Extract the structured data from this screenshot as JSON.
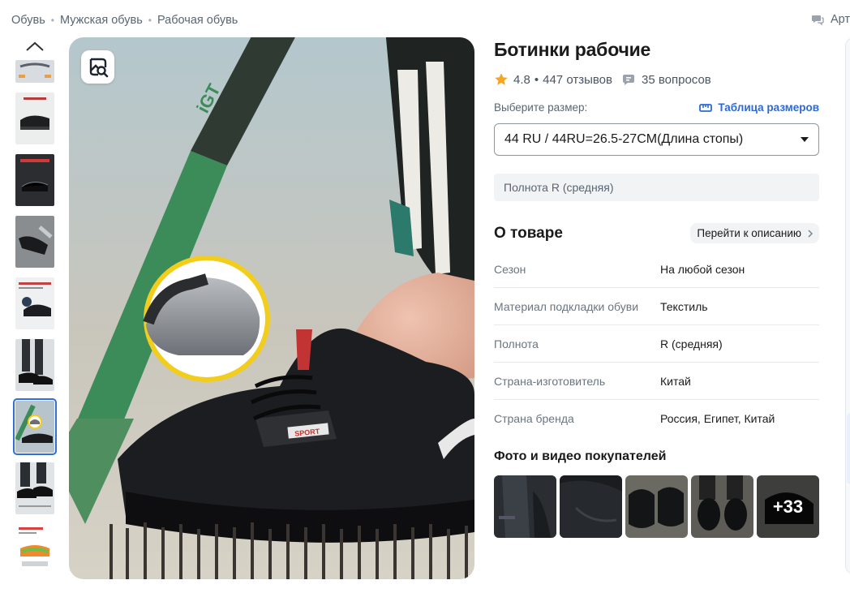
{
  "breadcrumb": [
    "Обувь",
    "Мужская обувь",
    "Рабочая обувь"
  ],
  "top_right_label": "Арт",
  "product": {
    "title": "Ботинки рабочие",
    "rating": "4.8",
    "reviews": "447 отзывов",
    "questions": "35 вопросов"
  },
  "size": {
    "label": "Выберите размер:",
    "table_link": "Таблица размеров",
    "selected": "44 RU / 44RU=26.5-27CM(Длина стопы)"
  },
  "fullness_text": "Полнота R (средняя)",
  "about": {
    "title": "О товаре",
    "link": "Перейти к описанию",
    "specs": [
      {
        "key": "Сезон",
        "value": "На любой сезон"
      },
      {
        "key": "Материал подкладки обуви",
        "value": "Текстиль"
      },
      {
        "key": "Полнота",
        "value": "R (средняя)"
      },
      {
        "key": "Страна-изготовитель",
        "value": "Китай"
      },
      {
        "key": "Страна бренда",
        "value": "Россия, Египет, Китай"
      }
    ]
  },
  "customer_photos": {
    "title": "Фото и видео покупателей",
    "more_count": "+33"
  },
  "main_image_text": {
    "hammer_brand": "iGT",
    "tag": "SPORT"
  },
  "colors": {
    "accent_blue": "#2b69d9",
    "star": "#f5a623",
    "selected_thumb_border": "#2f6fd6",
    "hammer_green": "#3c8c5a",
    "ring_yellow": "#f2cd1b"
  },
  "icons": {
    "zoom": "image-search-icon",
    "thumb_up": "chevron-up-icon",
    "star": "star-icon",
    "questions": "chat-bubble-icon",
    "size_table": "ruler-icon",
    "select_arrow": "caret-down-icon",
    "about_link": "chevron-right-icon"
  }
}
